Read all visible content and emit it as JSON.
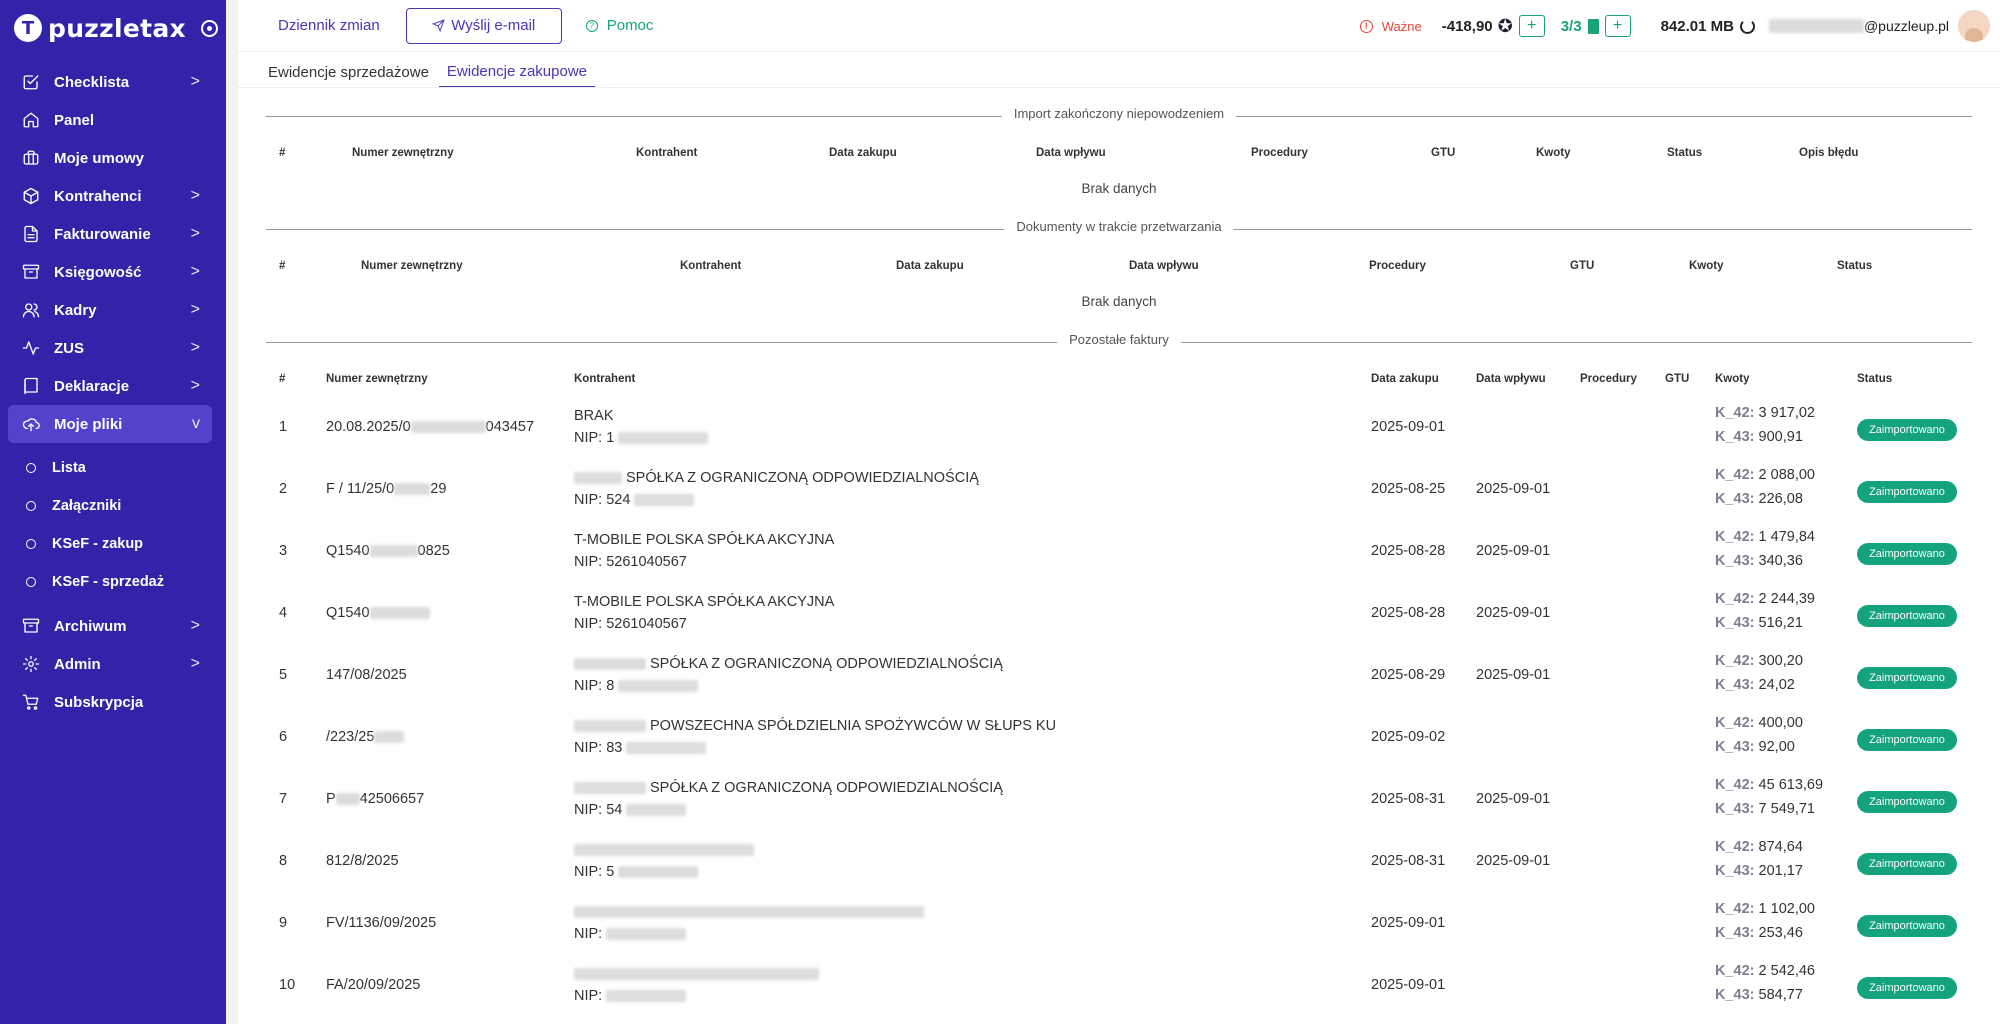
{
  "sidebar": {
    "brand": "puzzletax",
    "items": [
      {
        "label": "Checklista",
        "chevron": ">"
      },
      {
        "label": "Panel",
        "chevron": ""
      },
      {
        "label": "Moje umowy",
        "chevron": ""
      },
      {
        "label": "Kontrahenci",
        "chevron": ">"
      },
      {
        "label": "Fakturowanie",
        "chevron": ">"
      },
      {
        "label": "Księgowość",
        "chevron": ">"
      },
      {
        "label": "Kadry",
        "chevron": ">"
      },
      {
        "label": "ZUS",
        "chevron": ">"
      },
      {
        "label": "Deklaracje",
        "chevron": ">"
      },
      {
        "label": "Moje pliki",
        "chevron": "v"
      }
    ],
    "sub_items": [
      "Lista",
      "Załączniki",
      "KSeF - zakup",
      "KSeF - sprzedaż"
    ],
    "bottom_items": [
      {
        "label": "Archiwum",
        "chevron": ">"
      },
      {
        "label": "Admin",
        "chevron": ">"
      },
      {
        "label": "Subskrypcja",
        "chevron": ""
      }
    ]
  },
  "topbar": {
    "changelog": "Dziennik zmian",
    "send_email": "Wyślij e-mail",
    "help": "Pomoc",
    "important": "Ważne",
    "balance": "-418,90",
    "docs": "3/3",
    "storage": "842.01 MB",
    "email_suffix": "@puzzleup.pl"
  },
  "tabs": [
    "Ewidencje sprzedażowe",
    "Ewidencje zakupowe"
  ],
  "section1": {
    "title": "Import zakończony niepowodzeniem",
    "headers": [
      "#",
      "Numer zewnętrzny",
      "Kontrahent",
      "Data zakupu",
      "Data wpływu",
      "Procedury",
      "GTU",
      "Kwoty",
      "Status",
      "Opis błędu"
    ],
    "empty": "Brak danych"
  },
  "section2": {
    "title": "Dokumenty w trakcie przetwarzania",
    "headers": [
      "#",
      "Numer zewnętrzny",
      "Kontrahent",
      "Data zakupu",
      "Data wpływu",
      "Procedury",
      "GTU",
      "Kwoty",
      "Status"
    ],
    "empty": "Brak danych"
  },
  "section3": {
    "title": "Pozostałe faktury",
    "headers": [
      "#",
      "Numer zewnętrzny",
      "Kontrahent",
      "Data zakupu",
      "Data wpływu",
      "Procedury",
      "GTU",
      "Kwoty",
      "Status"
    ],
    "k42_label": "K_42:",
    "k43_label": "K_43:",
    "rows": [
      {
        "no": "1",
        "num": "20.08.2025/0",
        "num_tail": "043457",
        "contractor": "BRAK",
        "nip": "NIP: 1",
        "date_purchase": "2025-09-01",
        "date_receipt": "",
        "k42": "3 917,02",
        "k43": "900,91",
        "status": "Zaimportowano"
      },
      {
        "no": "2",
        "num": "F / 11/25/0",
        "num_tail": "29",
        "contractor": "SPÓŁKA Z OGRANICZONĄ ODPOWIEDZIALNOŚCIĄ",
        "nip": "NIP: 524",
        "date_purchase": "2025-08-25",
        "date_receipt": "2025-09-01",
        "k42": "2 088,00",
        "k43": "226,08",
        "status": "Zaimportowano"
      },
      {
        "no": "3",
        "num": "Q1540",
        "num_tail": "0825",
        "contractor": "T-MOBILE POLSKA SPÓŁKA AKCYJNA",
        "nip": "NIP: 5261040567",
        "date_purchase": "2025-08-28",
        "date_receipt": "2025-09-01",
        "k42": "1 479,84",
        "k43": "340,36",
        "status": "Zaimportowano"
      },
      {
        "no": "4",
        "num": "Q1540",
        "num_tail": "",
        "contractor": "T-MOBILE POLSKA SPÓŁKA AKCYJNA",
        "nip": "NIP: 5261040567",
        "date_purchase": "2025-08-28",
        "date_receipt": "2025-09-01",
        "k42": "2 244,39",
        "k43": "516,21",
        "status": "Zaimportowano"
      },
      {
        "no": "5",
        "num": "147/08/2025",
        "num_tail": "",
        "contractor": "SPÓŁKA Z OGRANICZONĄ ODPOWIEDZIALNOŚCIĄ",
        "nip": "NIP: 8",
        "date_purchase": "2025-08-29",
        "date_receipt": "2025-09-01",
        "k42": "300,20",
        "k43": "24,02",
        "status": "Zaimportowano"
      },
      {
        "no": "6",
        "num": "/223/25",
        "num_tail": "",
        "contractor": "POWSZECHNA SPÓŁDZIELNIA SPOŻYWCÓW W SŁUPS KU",
        "nip": "NIP: 83",
        "date_purchase": "2025-09-02",
        "date_receipt": "",
        "k42": "400,00",
        "k43": "92,00",
        "status": "Zaimportowano"
      },
      {
        "no": "7",
        "num": "P",
        "num_tail": "42506657",
        "contractor": "SPÓŁKA Z OGRANICZONĄ ODPOWIEDZIALNOŚCIĄ",
        "nip": "NIP: 54",
        "date_purchase": "2025-08-31",
        "date_receipt": "2025-09-01",
        "k42": "45 613,69",
        "k43": "7 549,71",
        "status": "Zaimportowano"
      },
      {
        "no": "8",
        "num": "812/8/2025",
        "num_tail": "",
        "contractor": "",
        "nip": "NIP: 5",
        "date_purchase": "2025-08-31",
        "date_receipt": "2025-09-01",
        "k42": "874,64",
        "k43": "201,17",
        "status": "Zaimportowano"
      },
      {
        "no": "9",
        "num": "FV/1136/09/2025",
        "num_tail": "",
        "contractor": "",
        "nip": "NIP:",
        "date_purchase": "2025-09-01",
        "date_receipt": "",
        "k42": "1 102,00",
        "k43": "253,46",
        "status": "Zaimportowano"
      },
      {
        "no": "10",
        "num": "FA/20/09/2025",
        "num_tail": "",
        "contractor": "",
        "nip": "NIP:",
        "date_purchase": "2025-09-01",
        "date_receipt": "",
        "k42": "2 542,46",
        "k43": "584,77",
        "status": "Zaimportowano"
      }
    ]
  }
}
